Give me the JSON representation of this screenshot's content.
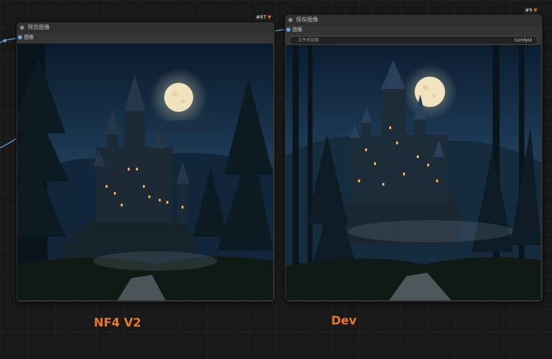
{
  "nodes": {
    "preview": {
      "title": "预览图像",
      "id_badge": "#87",
      "input_label": "图像"
    },
    "save": {
      "title": "保存图像",
      "id_badge": "#9",
      "input_label": "图像",
      "filename_prefix_label": "文件名前缀",
      "filename_prefix_value": "ComfyUI"
    }
  },
  "captions": {
    "left": "NF4 V2",
    "right": "Dev"
  },
  "colors": {
    "accent_caption": "#e8792a",
    "wire": "#6aa7e0",
    "canvas_bg": "#181818"
  }
}
